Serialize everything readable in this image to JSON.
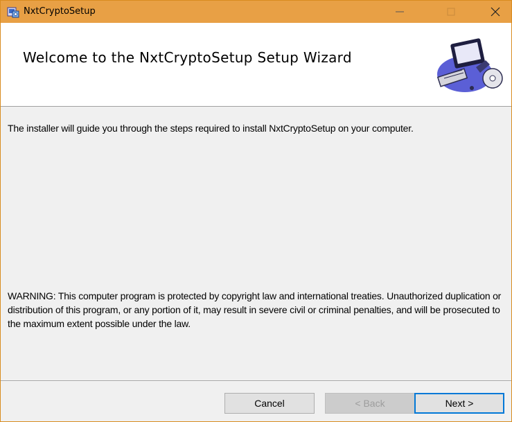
{
  "window": {
    "title": "NxtCryptoSetup",
    "icon": "installer-icon",
    "controls": {
      "minimize_glyph": "—",
      "maximize_glyph": "☐",
      "close_glyph": "✕"
    },
    "title_bar_color": "#e8a045"
  },
  "header": {
    "title": "Welcome to the NxtCryptoSetup Setup Wizard",
    "art_icon": "computer-with-cd-icon"
  },
  "content": {
    "intro": "The installer will guide you through the steps required to install NxtCryptoSetup on your computer.",
    "warning": "WARNING: This computer program is protected by copyright law and international treaties. Unauthorized duplication or distribution of this program, or any portion of it, may result in severe civil or criminal penalties, and will be prosecuted to the maximum extent possible under the law."
  },
  "footer": {
    "cancel_label": "Cancel",
    "back_label": "< Back",
    "next_label": "Next >"
  }
}
